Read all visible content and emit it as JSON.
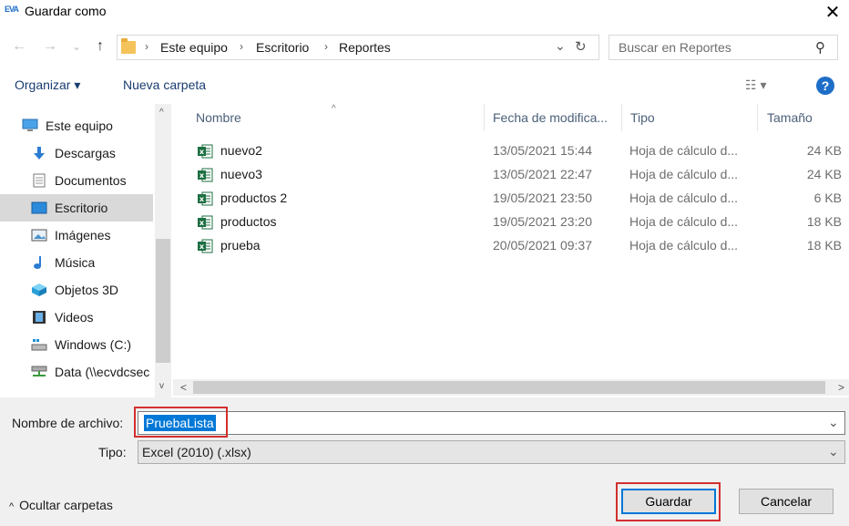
{
  "window": {
    "logo": "EVA",
    "title": "Guardar como",
    "close": "✕"
  },
  "nav": {
    "back": "←",
    "forward": "→",
    "recent": "⌄",
    "up": "↑"
  },
  "address": {
    "crumbs": [
      "Este equipo",
      "Escritorio",
      "Reportes"
    ],
    "separator": "›",
    "dropdown": "⌄",
    "refresh": "↻"
  },
  "search": {
    "placeholder": "Buscar en Reportes",
    "icon": "⚲"
  },
  "toolbar": {
    "organize": "Organizar ▾",
    "new_folder": "Nueva carpeta",
    "view": "☷ ▾",
    "help": "?"
  },
  "sidebar": {
    "items": [
      {
        "label": "Este equipo",
        "icon": "computer-icon"
      },
      {
        "label": "Descargas",
        "icon": "download-icon"
      },
      {
        "label": "Documentos",
        "icon": "document-icon"
      },
      {
        "label": "Escritorio",
        "icon": "desktop-icon",
        "selected": true
      },
      {
        "label": "Imágenes",
        "icon": "pictures-icon"
      },
      {
        "label": "Música",
        "icon": "music-icon"
      },
      {
        "label": "Objetos 3D",
        "icon": "cube-icon"
      },
      {
        "label": "Videos",
        "icon": "film-icon"
      },
      {
        "label": "Windows (C:)",
        "icon": "drive-icon"
      },
      {
        "label": "Data (\\\\ecvdcsec",
        "icon": "network-drive-icon"
      }
    ],
    "scroll_up": "^",
    "scroll_down": "v"
  },
  "columns": {
    "name": "Nombre",
    "date": "Fecha de modifica...",
    "type": "Tipo",
    "size": "Tamaño"
  },
  "files": [
    {
      "name": "nuevo2",
      "date": "13/05/2021 15:44",
      "type": "Hoja de cálculo d...",
      "size": "24 KB"
    },
    {
      "name": "nuevo3",
      "date": "13/05/2021 22:47",
      "type": "Hoja de cálculo d...",
      "size": "24 KB"
    },
    {
      "name": "productos 2",
      "date": "19/05/2021 23:50",
      "type": "Hoja de cálculo d...",
      "size": "6 KB"
    },
    {
      "name": "productos",
      "date": "19/05/2021 23:20",
      "type": "Hoja de cálculo d...",
      "size": "18 KB"
    },
    {
      "name": "prueba",
      "date": "20/05/2021 09:37",
      "type": "Hoja de cálculo d...",
      "size": "18 KB"
    }
  ],
  "hscroll": {
    "left": "<",
    "right": ">"
  },
  "form": {
    "filename_label": "Nombre de archivo:",
    "filename_value": "PruebaLista",
    "type_label": "Tipo:",
    "type_value": "Excel (2010) (.xlsx)",
    "dropdown": "⌄"
  },
  "footer": {
    "hide_folders": "Ocultar carpetas",
    "save": "Guardar",
    "cancel": "Cancelar"
  },
  "colors": {
    "accent": "#0078d7",
    "highlight_box": "#d32f2f",
    "link": "#1a3d70",
    "excel": "#1d6f42"
  }
}
